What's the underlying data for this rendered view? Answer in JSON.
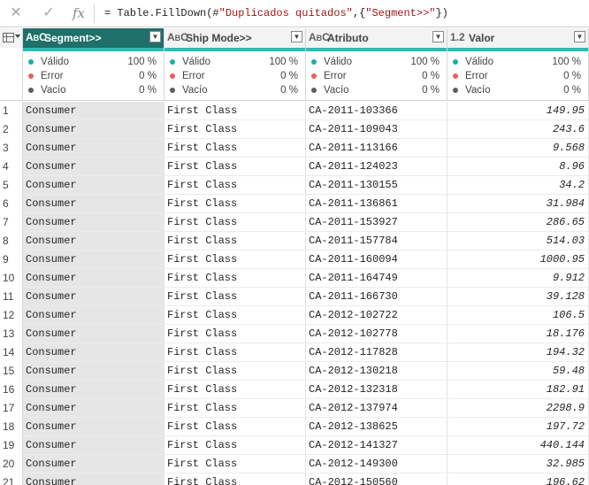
{
  "formula_bar": {
    "cancel_icon": "close-icon",
    "confirm_icon": "check-icon",
    "fx_label": "fx",
    "formula_prefix": "= Table.FillDown(#",
    "formula_str1": "\"Duplicados quitados\"",
    "formula_mid": ",{",
    "formula_str2": "\"Segment>>\"",
    "formula_suffix": "})"
  },
  "columns": [
    {
      "type": "ABC",
      "name": "Segment>>",
      "selected": true
    },
    {
      "type": "ABC",
      "name": "Ship Mode>>",
      "selected": false
    },
    {
      "type": "ABC",
      "name": "Atributo",
      "selected": false
    },
    {
      "type": "1.2",
      "name": "Valor",
      "selected": false
    }
  ],
  "quality": {
    "labels": [
      "Válido",
      "Error",
      "Vacío"
    ],
    "colors": [
      "#1aaf9f",
      "#e8625a",
      "#605e5c"
    ],
    "values": [
      [
        "100 %",
        "0 %",
        "0 %"
      ],
      [
        "100 %",
        "0 %",
        "0 %"
      ],
      [
        "100 %",
        "0 %",
        "0 %"
      ],
      [
        "100 %",
        "0 %",
        "0 %"
      ]
    ]
  },
  "rows": [
    [
      "Consumer",
      "First Class",
      "CA-2011-103366",
      "149.95"
    ],
    [
      "Consumer",
      "First Class",
      "CA-2011-109043",
      "243.6"
    ],
    [
      "Consumer",
      "First Class",
      "CA-2011-113166",
      "9.568"
    ],
    [
      "Consumer",
      "First Class",
      "CA-2011-124023",
      "8.96"
    ],
    [
      "Consumer",
      "First Class",
      "CA-2011-130155",
      "34.2"
    ],
    [
      "Consumer",
      "First Class",
      "CA-2011-136861",
      "31.984"
    ],
    [
      "Consumer",
      "First Class",
      "CA-2011-153927",
      "286.65"
    ],
    [
      "Consumer",
      "First Class",
      "CA-2011-157784",
      "514.03"
    ],
    [
      "Consumer",
      "First Class",
      "CA-2011-160094",
      "1000.95"
    ],
    [
      "Consumer",
      "First Class",
      "CA-2011-164749",
      "9.912"
    ],
    [
      "Consumer",
      "First Class",
      "CA-2011-166730",
      "39.128"
    ],
    [
      "Consumer",
      "First Class",
      "CA-2012-102722",
      "106.5"
    ],
    [
      "Consumer",
      "First Class",
      "CA-2012-102778",
      "18.176"
    ],
    [
      "Consumer",
      "First Class",
      "CA-2012-117828",
      "194.32"
    ],
    [
      "Consumer",
      "First Class",
      "CA-2012-130218",
      "59.48"
    ],
    [
      "Consumer",
      "First Class",
      "CA-2012-132318",
      "182.91"
    ],
    [
      "Consumer",
      "First Class",
      "CA-2012-137974",
      "2298.9"
    ],
    [
      "Consumer",
      "First Class",
      "CA-2012-138625",
      "197.72"
    ],
    [
      "Consumer",
      "First Class",
      "CA-2012-141327",
      "440.144"
    ],
    [
      "Consumer",
      "First Class",
      "CA-2012-149300",
      "32.985"
    ],
    [
      "Consumer",
      "First Class",
      "CA-2012-150560",
      "196.62"
    ]
  ]
}
